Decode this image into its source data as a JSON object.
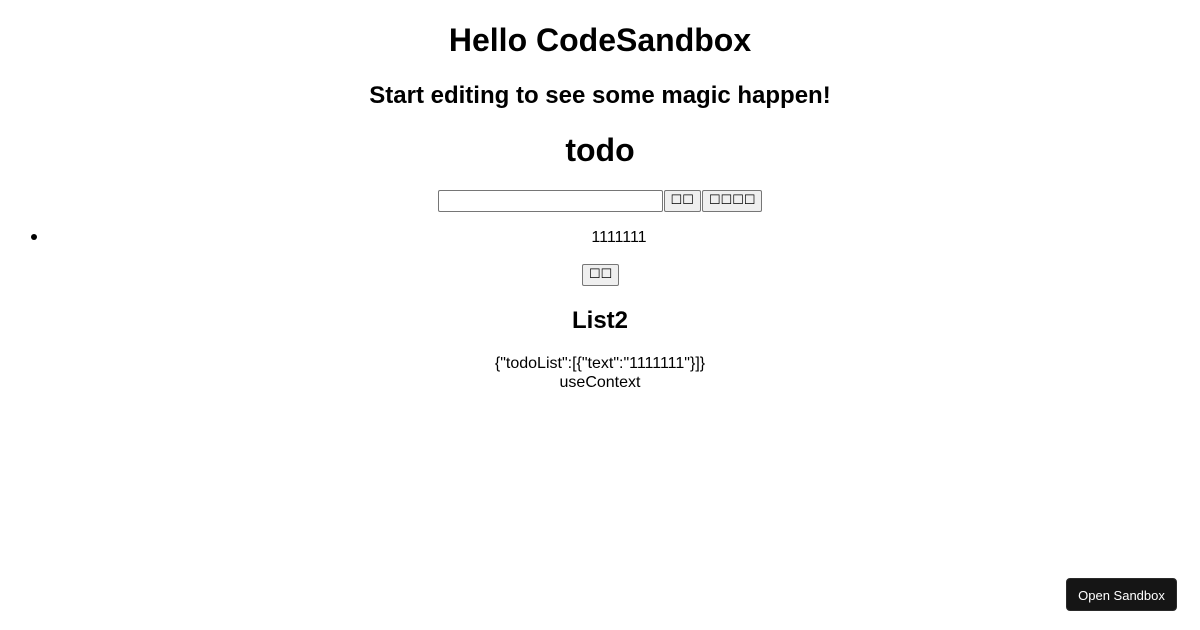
{
  "header": {
    "title": "Hello CodeSandbox",
    "subtitle": "Start editing to see some magic happen!"
  },
  "todo": {
    "title": "todo",
    "input": {
      "value": "",
      "placeholder": ""
    },
    "add_button_label": "☐☐",
    "clear_button_label": "☐☐☐☐",
    "items": [
      {
        "text": "1111111",
        "action_label": "☐☐"
      }
    ]
  },
  "list2": {
    "title": "List2",
    "json_text": "{\"todoList\":[{\"text\":\"1111111\"}]}",
    "context_text": "useContext"
  },
  "sandbox_button": {
    "label": "Open Sandbox"
  },
  "colors": {
    "background": "#ffffff",
    "sandbox_button_bg": "#151515",
    "sandbox_button_text": "#ffffff",
    "button_bg": "#efefef"
  }
}
